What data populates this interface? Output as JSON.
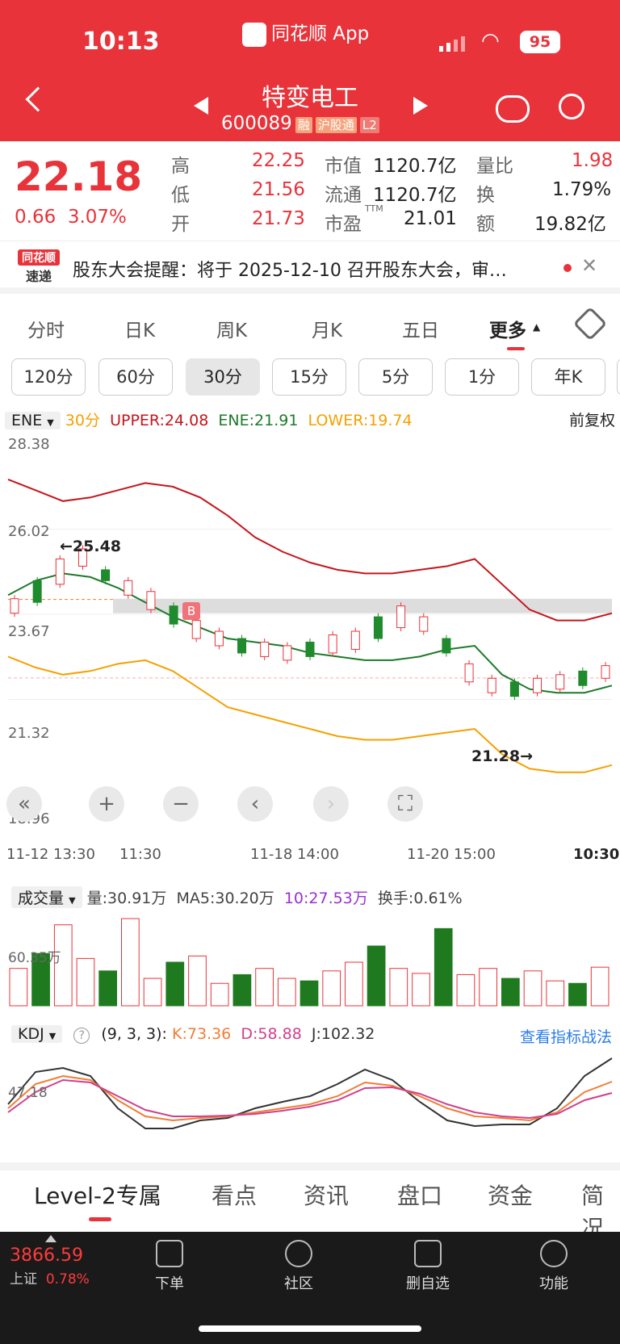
{
  "status_bar": {
    "time": "10:13",
    "app": "同花顺 App",
    "battery": "95"
  },
  "header": {
    "name": "特变电工",
    "code": "600089",
    "tags": [
      "融",
      "沪股通",
      "L2"
    ]
  },
  "quote": {
    "price": "22.18",
    "change": "0.66",
    "change_pct": "3.07%",
    "high_label": "高",
    "high": "22.25",
    "low_label": "低",
    "low": "21.56",
    "open_label": "开",
    "open": "21.73",
    "mcap_label": "市值",
    "mcap": "1120.7亿",
    "float_label": "流通",
    "float": "1120.7亿",
    "pe_label": "市盈",
    "pe_sup": "TTM",
    "pe": "21.01",
    "vr_label": "量比",
    "vr": "1.98",
    "turn_label": "换",
    "turn": "1.79%",
    "amt_label": "额",
    "amt": "19.82亿"
  },
  "news": {
    "logo_top": "同花顺",
    "logo_bottom": "速递",
    "text": "股东大会提醒：将于 2025-12-10 召开股东大会，审…"
  },
  "tabs": [
    "分时",
    "日K",
    "周K",
    "月K",
    "五日",
    "更多"
  ],
  "periods": [
    "120分",
    "60分",
    "30分",
    "15分",
    "5分",
    "1分",
    "年K"
  ],
  "indicator": {
    "name": "ENE",
    "period": "30分",
    "upper": "UPPER:24.08",
    "ene": "ENE:21.91",
    "lower": "LOWER:19.74",
    "adjust": "前复权"
  },
  "y_axis": [
    "28.38",
    "26.02",
    "23.67",
    "21.32",
    "18.96"
  ],
  "x_axis": [
    "11-12 13:30",
    "11:30",
    "11-18 14:00",
    "11-20 15:00",
    "10:30"
  ],
  "annotations": {
    "high": "←25.48",
    "low": "21.28→",
    "buy": "B"
  },
  "volume": {
    "name": "成交量",
    "vol": "量:30.91万",
    "ma5": "MA5:30.20万",
    "ma10": "10:27.53万",
    "turnover": "换手:0.61%",
    "axis_label": "60.35万"
  },
  "kdj": {
    "name": "KDJ",
    "params": "(9, 3, 3):",
    "k": "K:73.36",
    "d": "D:58.88",
    "j": "J:102.32",
    "link": "查看指标战法",
    "axis_label": "47.18"
  },
  "bottom_tabs": [
    "Level-2专属",
    "看点",
    "资讯",
    "盘口",
    "资金",
    "简况"
  ],
  "index": {
    "value": "3866.59",
    "name": "上证",
    "pct": "0.78%"
  },
  "nav": [
    "下单",
    "社区",
    "删自选",
    "功能"
  ],
  "chart_data": {
    "type": "candlestick",
    "ylim": [
      18.96,
      28.38
    ],
    "upper": [
      27.4,
      27.1,
      26.8,
      26.9,
      27.1,
      27.3,
      27.2,
      26.9,
      26.4,
      25.8,
      25.4,
      25.1,
      24.9,
      24.8,
      24.8,
      24.9,
      25.0,
      25.2,
      24.5,
      23.8,
      23.5,
      23.5,
      23.7
    ],
    "ene": [
      24.2,
      24.6,
      24.8,
      24.7,
      24.4,
      24.0,
      23.6,
      23.3,
      23.0,
      22.9,
      22.8,
      22.6,
      22.5,
      22.4,
      22.4,
      22.5,
      22.7,
      22.8,
      22.0,
      21.6,
      21.5,
      21.5,
      21.7
    ],
    "lower": [
      22.5,
      22.2,
      22.0,
      22.1,
      22.3,
      22.4,
      22.1,
      21.6,
      21.1,
      20.9,
      20.7,
      20.5,
      20.3,
      20.2,
      20.2,
      20.3,
      20.4,
      20.5,
      19.8,
      19.4,
      19.3,
      19.3,
      19.5
    ],
    "candles": [
      [
        23.7,
        24.1
      ],
      [
        24.0,
        24.6
      ],
      [
        24.5,
        25.2
      ],
      [
        25.0,
        25.48
      ],
      [
        24.6,
        24.9
      ],
      [
        24.2,
        24.6
      ],
      [
        23.8,
        24.3
      ],
      [
        23.4,
        23.9
      ],
      [
        23.0,
        23.5
      ],
      [
        22.8,
        23.2
      ],
      [
        22.6,
        23.0
      ],
      [
        22.5,
        22.9
      ],
      [
        22.4,
        22.8
      ],
      [
        22.5,
        22.9
      ],
      [
        22.6,
        23.1
      ],
      [
        22.7,
        23.2
      ],
      [
        23.0,
        23.6
      ],
      [
        23.3,
        23.9
      ],
      [
        23.2,
        23.6
      ],
      [
        22.6,
        23.0
      ],
      [
        21.8,
        22.3
      ],
      [
        21.5,
        21.9
      ],
      [
        21.4,
        21.8
      ],
      [
        21.5,
        21.9
      ],
      [
        21.6,
        22.0
      ],
      [
        21.7,
        22.1
      ],
      [
        21.9,
        22.25
      ]
    ],
    "volume": [
      30,
      42,
      65,
      38,
      28,
      70,
      22,
      35,
      40,
      18,
      25,
      30,
      22,
      20,
      28,
      35,
      48,
      30,
      26,
      62,
      25,
      30,
      22,
      28,
      20,
      18,
      31
    ],
    "kdj_k": [
      40,
      70,
      80,
      75,
      50,
      30,
      25,
      28,
      30,
      35,
      40,
      45,
      55,
      72,
      68,
      55,
      40,
      30,
      28,
      25,
      35,
      60,
      73
    ],
    "kdj_d": [
      35,
      60,
      75,
      72,
      55,
      38,
      30,
      30,
      31,
      33,
      37,
      42,
      50,
      65,
      66,
      58,
      45,
      35,
      30,
      28,
      33,
      50,
      59
    ],
    "kdj_j": [
      45,
      85,
      90,
      80,
      40,
      15,
      15,
      25,
      28,
      40,
      48,
      55,
      70,
      88,
      75,
      48,
      25,
      18,
      20,
      20,
      40,
      80,
      102
    ]
  }
}
